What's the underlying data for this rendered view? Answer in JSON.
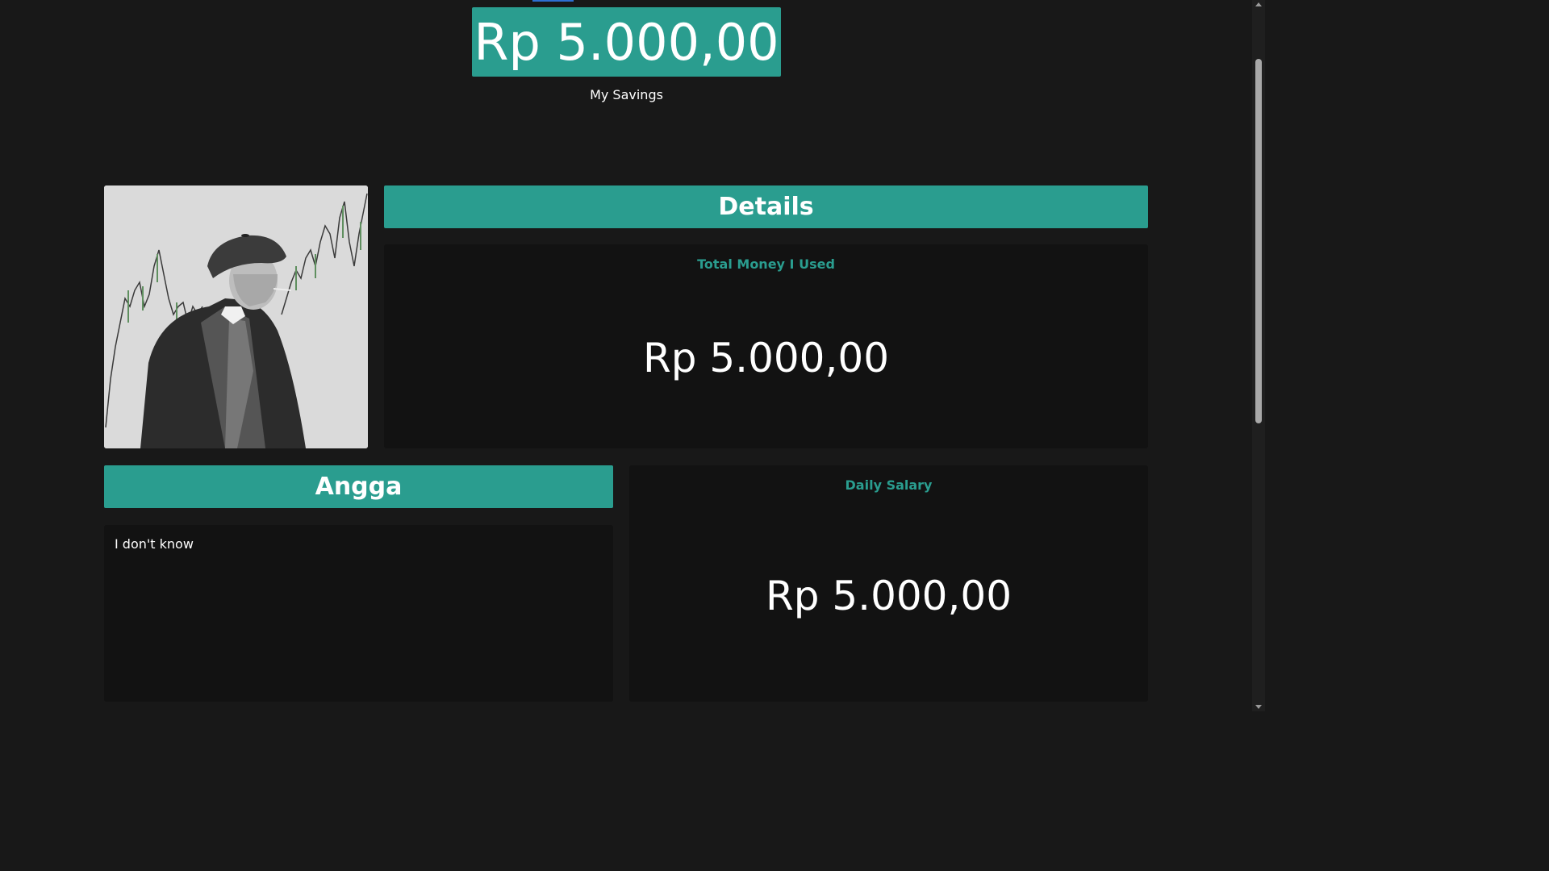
{
  "savings": {
    "amount": "Rp 5.000,00",
    "label": "My Savings"
  },
  "profile": {
    "avatar_icon": "portrait-illustration",
    "name": "Angga",
    "bio": "I don't know"
  },
  "details": {
    "header": "Details",
    "total_used": {
      "title": "Total Money I Used",
      "value": "Rp 5.000,00"
    },
    "daily_salary": {
      "title": "Daily Salary",
      "value": "Rp 5.000,00"
    }
  },
  "colors": {
    "accent": "#2a9d8f",
    "background": "#181818",
    "card": "#121212"
  }
}
